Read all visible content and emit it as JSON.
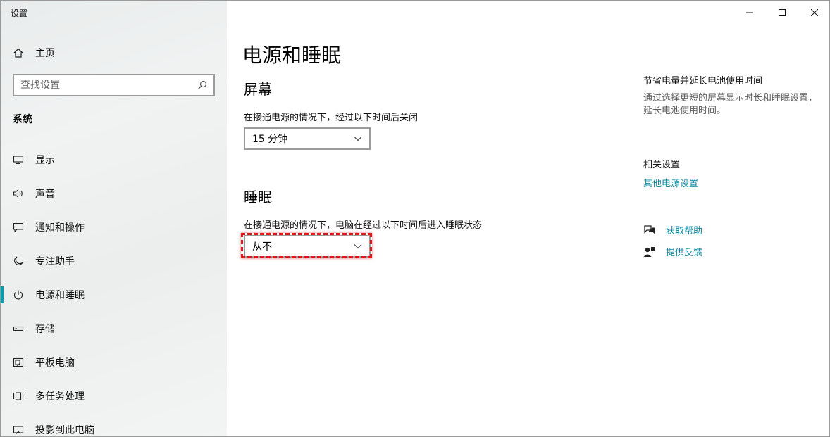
{
  "app_title": "设置",
  "sidebar": {
    "home_label": "主页",
    "search_placeholder": "查找设置",
    "section_title": "系统",
    "items": [
      {
        "label": "显示"
      },
      {
        "label": "声音"
      },
      {
        "label": "通知和操作"
      },
      {
        "label": "专注助手"
      },
      {
        "label": "电源和睡眠"
      },
      {
        "label": "存储"
      },
      {
        "label": "平板电脑"
      },
      {
        "label": "多任务处理"
      },
      {
        "label": "投影到此电脑"
      }
    ],
    "active_item": "电源和睡眠"
  },
  "main": {
    "title": "电源和睡眠",
    "screen": {
      "heading": "屏幕",
      "desc": "在接通电源的情况下，经过以下时间后关闭",
      "value": "15 分钟"
    },
    "sleep": {
      "heading": "睡眠",
      "desc": "在接通电源的情况下，电脑在经过以下时间后进入睡眠状态",
      "value": "从不"
    }
  },
  "right": {
    "tip_title": "节省电量并延长电池使用时间",
    "tip_desc": "通过选择更短的屏幕显示时长和睡眠设置，延长电池使用时间。",
    "related_title": "相关设置",
    "related_link": "其他电源设置",
    "help_label": "获取帮助",
    "feedback_label": "提供反馈"
  },
  "colors": {
    "accent": "#00a0b0",
    "link": "#0a8aa0",
    "highlight": "#e0141c"
  }
}
